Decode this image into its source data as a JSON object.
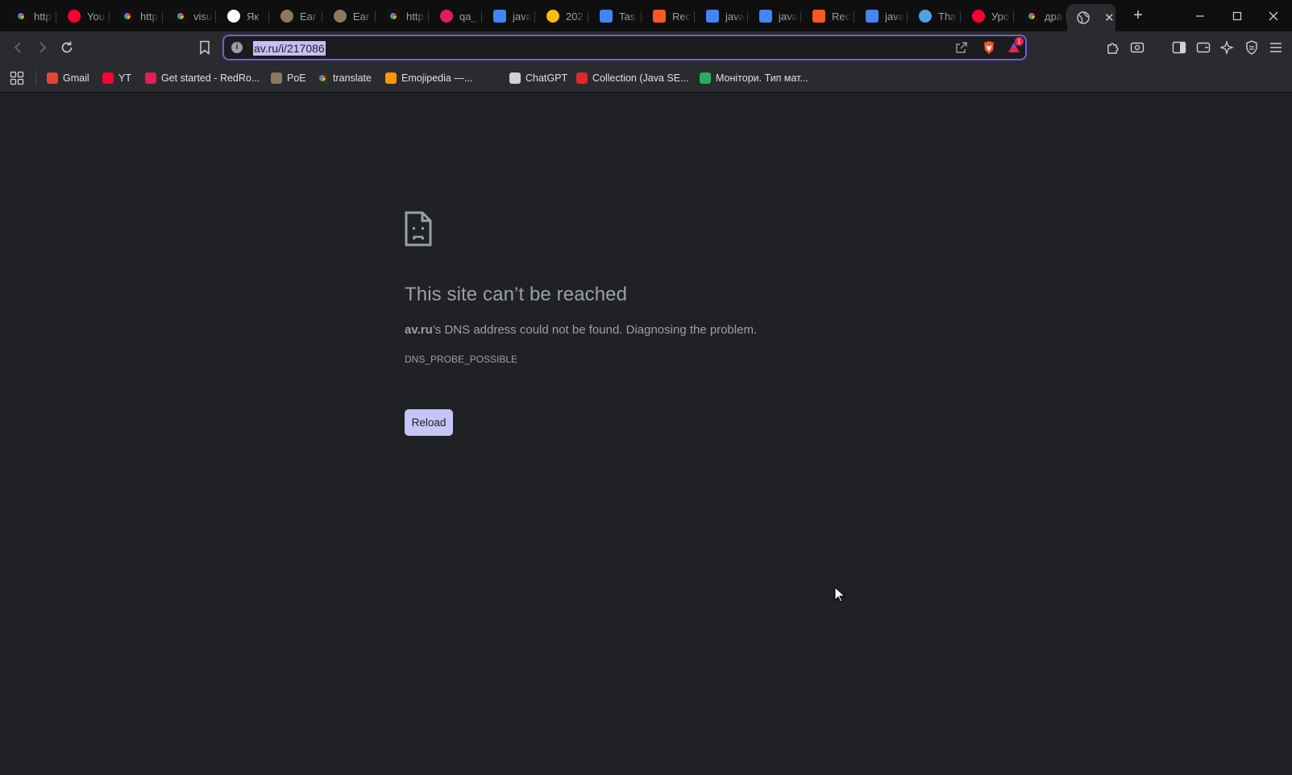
{
  "tabs": [
    {
      "title": "http",
      "icon": "google-icon",
      "color": "#ffffff"
    },
    {
      "title": "You",
      "icon": "youtube-icon",
      "color": "#ff0033"
    },
    {
      "title": "http",
      "icon": "google-icon",
      "color": "#ffffff"
    },
    {
      "title": "visu",
      "icon": "google-icon",
      "color": "#ffffff"
    },
    {
      "title": "Як",
      "icon": "dou-icon",
      "color": "#ffffff"
    },
    {
      "title": "Ear",
      "icon": "eye-icon",
      "color": "#8a7a60"
    },
    {
      "title": "Ear",
      "icon": "eye-icon",
      "color": "#8a7a60"
    },
    {
      "title": "http",
      "icon": "google-icon",
      "color": "#ffffff"
    },
    {
      "title": "qa_",
      "icon": "slack-icon",
      "color": "#e01e5a"
    },
    {
      "title": "java",
      "icon": "docs-icon",
      "color": "#4285f4"
    },
    {
      "title": "202",
      "icon": "drive-icon",
      "color": "#fbbc04"
    },
    {
      "title": "Tas",
      "icon": "docs-icon",
      "color": "#4285f4"
    },
    {
      "title": "Rec",
      "icon": "brave-talk-icon",
      "color": "#ff5722"
    },
    {
      "title": "java",
      "icon": "docs-icon",
      "color": "#4285f4"
    },
    {
      "title": "java",
      "icon": "docs-icon",
      "color": "#4285f4"
    },
    {
      "title": "Rec",
      "icon": "brave-talk-icon",
      "color": "#ff5722"
    },
    {
      "title": "java",
      "icon": "docs-icon",
      "color": "#4285f4"
    },
    {
      "title": "Tha",
      "icon": "drop-icon",
      "color": "#4fa3e0"
    },
    {
      "title": "Уро",
      "icon": "youtube-icon",
      "color": "#ff0033"
    },
    {
      "title": "дра",
      "icon": "google-icon",
      "color": "#ffffff"
    }
  ],
  "active_tab": {
    "icon": "globe-icon",
    "close_label": "✕"
  },
  "new_tab_label": "+",
  "address_bar": {
    "url": "av.ru/i/217086",
    "notification_count": "1"
  },
  "bookmarks": [
    {
      "label": "Gmail",
      "icon": "gmail-icon",
      "color": "#ea4335"
    },
    {
      "label": "YT",
      "icon": "youtube-icon",
      "color": "#ff0033"
    },
    {
      "label": "Get started - RedRo...",
      "icon": "slack-icon",
      "color": "#e01e5a"
    },
    {
      "label": "PoE",
      "icon": "poe-icon",
      "color": "#8a7a60"
    },
    {
      "label": "translate",
      "icon": "google-icon",
      "color": "#ffffff"
    },
    {
      "label": "Emojipedia —...",
      "icon": "emojipedia-icon",
      "color": "#ff9800"
    },
    {
      "label": "ChatGPT",
      "icon": "chatgpt-icon",
      "color": "#d0d0d0"
    },
    {
      "label": "Collection (Java SE...",
      "icon": "oracle-icon",
      "color": "#e3262b"
    },
    {
      "label": "Монітори. Тип мат...",
      "icon": "rozetka-icon",
      "color": "#27ae60"
    }
  ],
  "error_page": {
    "title": "This site can’t be reached",
    "host": "av.ru",
    "message": "’s DNS address could not be found. Diagnosing the problem.",
    "code": "DNS_PROBE_POSSIBLE",
    "reload_label": "Reload"
  },
  "colors": {
    "background": "#202124",
    "url_outline": "#6e5fd8",
    "reload_button": "#c7c4f7"
  }
}
